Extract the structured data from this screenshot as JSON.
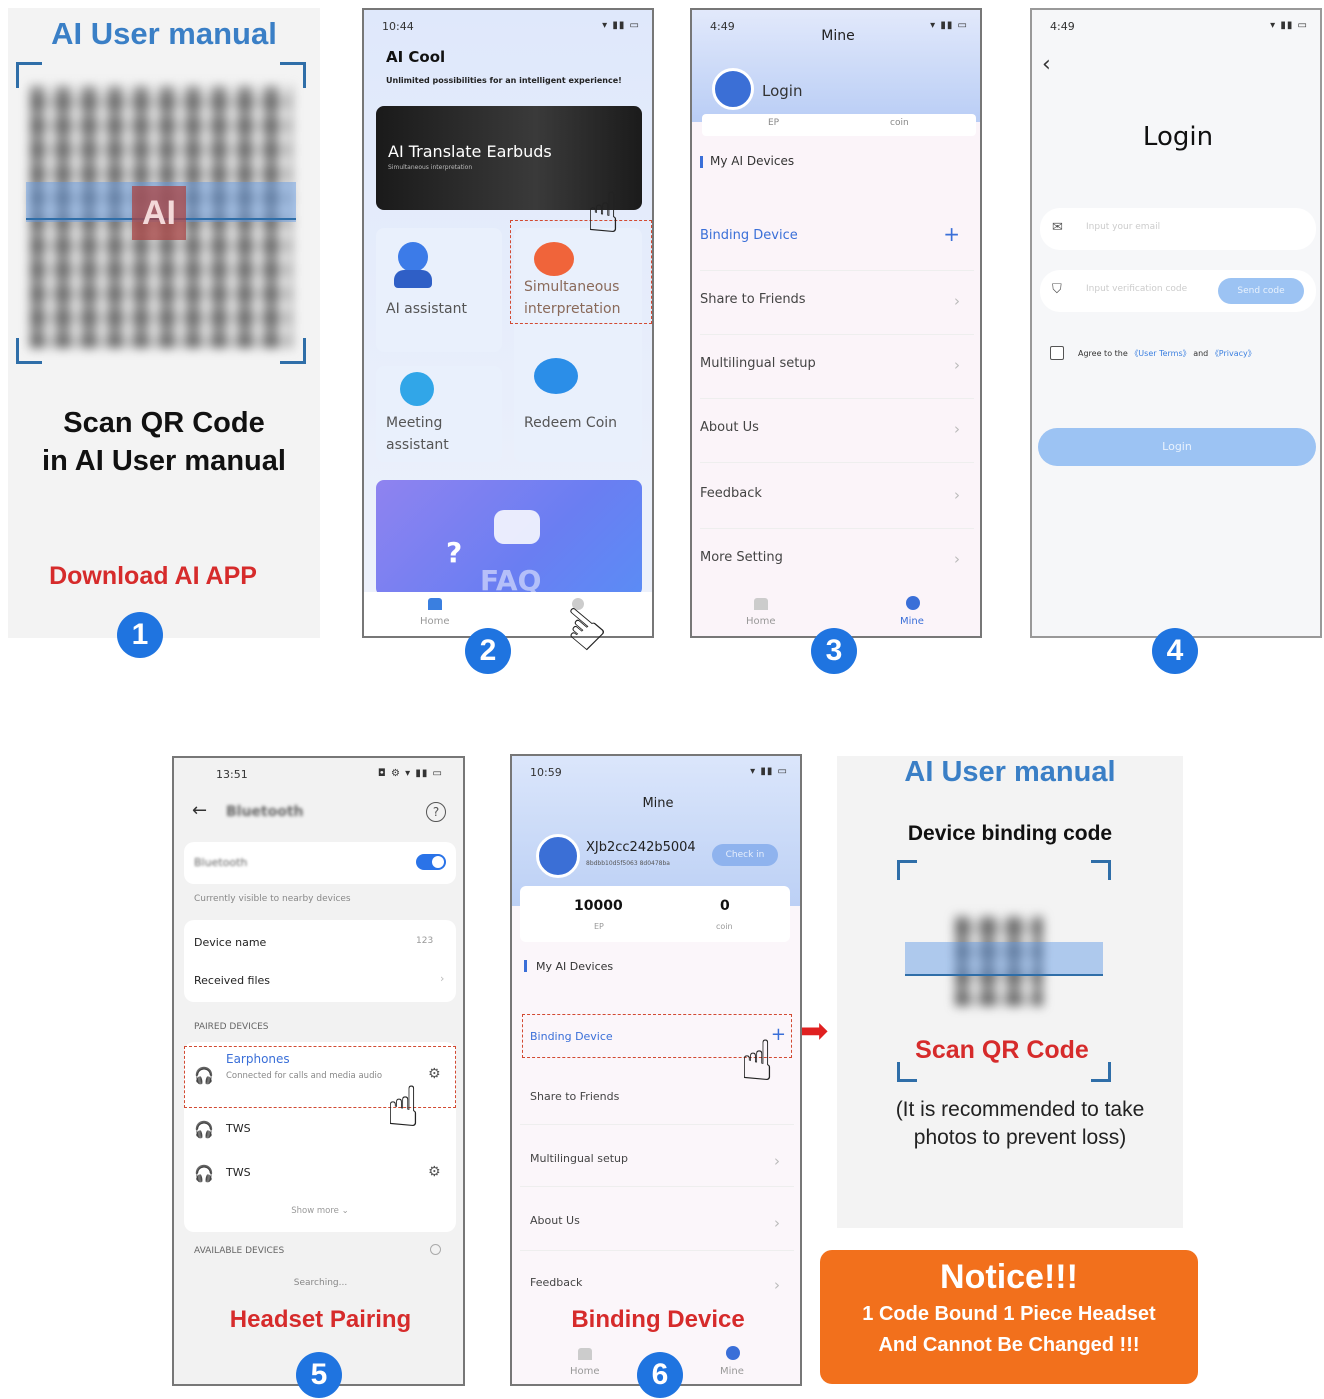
{
  "panel1": {
    "title": "AI User manual",
    "qr_logo": "AI",
    "scan_line1": "Scan QR Code",
    "scan_line2": "in AI User manual",
    "download": "Download AI APP",
    "step": "1"
  },
  "phone2": {
    "time": "10:44",
    "app_title": "AI Cool",
    "subtitle": "Unlimited possibilities for an intelligent experience!",
    "banner_title": "AI Translate Earbuds",
    "banner_sub": "Simultaneous interpretation",
    "tile_assistant": "AI assistant",
    "tile_simul_1": "Simultaneous",
    "tile_simul_2": "interpretation",
    "tile_meeting_1": "Meeting",
    "tile_meeting_2": "assistant",
    "tile_redeem": "Redeem Coin",
    "faq": "FAQ",
    "tab_home": "Home",
    "step": "2"
  },
  "phone3": {
    "time": "4:49",
    "title": "Mine",
    "login": "Login",
    "ep": "EP",
    "coin": "coin",
    "section": "My AI Devices",
    "binding": "Binding Device",
    "items": [
      "Share to Friends",
      "Multilingual setup",
      "About Us",
      "Feedback",
      "More Setting"
    ],
    "tab_home": "Home",
    "tab_mine": "Mine",
    "step": "3"
  },
  "phone4": {
    "time": "4:49",
    "title": "Login",
    "email_placeholder": "Input your email",
    "code_placeholder": "Input verification code",
    "send_code": "Send code",
    "agree_prefix": "Agree to the",
    "user_terms": "《User Terms》",
    "and": "and",
    "privacy": "《Privacy》",
    "login_button": "Login",
    "step": "4"
  },
  "phone5": {
    "time": "13:51",
    "title": "Bluetooth",
    "bt_label": "Bluetooth",
    "visible": "Currently visible to nearby devices",
    "device_name": "Device name",
    "device_name_value": "123",
    "received_files": "Received files",
    "paired_header": "PAIRED DEVICES",
    "earphones": "Earphones",
    "earphones_status": "Connected for calls and media audio",
    "tws1": "TWS",
    "tws2": "TWS",
    "show_more": "Show more",
    "available_header": "AVAILABLE DEVICES",
    "searching": "Searching...",
    "caption": "Headset Pairing",
    "step": "5"
  },
  "phone6": {
    "time": "10:59",
    "title": "Mine",
    "username": "XJb2cc242b5004",
    "userid": "8bdbb10d5f5063 8d0478ba",
    "checkin": "Check in",
    "ep_value": "10000",
    "coin_value": "0",
    "ep": "EP",
    "coin": "coin",
    "section": "My AI Devices",
    "binding": "Binding Device",
    "items": [
      "Share to Friends",
      "Multilingual setup",
      "About Us",
      "Feedback"
    ],
    "tab_home": "Home",
    "tab_mine": "Mine",
    "caption": "Binding Device",
    "step": "6"
  },
  "panel7": {
    "title": "AI User manual",
    "binding_code": "Device binding code",
    "scan": "Scan QR Code",
    "rec_line1": "(It is recommended to take",
    "rec_line2": "photos to prevent loss)"
  },
  "notice": {
    "title": "Notice!!!",
    "line1": "1 Code Bound 1 Piece Headset",
    "line2": "And Cannot Be Changed !!!"
  },
  "colors": {
    "accent_blue": "#1f74e0",
    "red": "#d62b2b",
    "orange": "#f2701c"
  }
}
